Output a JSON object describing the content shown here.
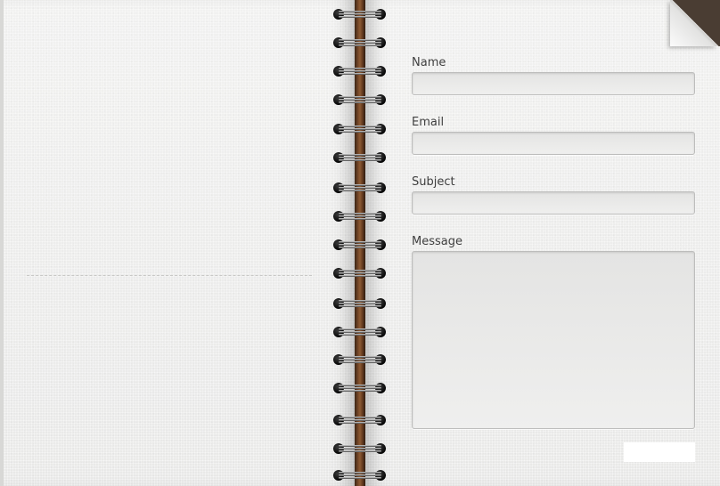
{
  "form": {
    "name_label": "Name",
    "name_value": "",
    "email_label": "Email",
    "email_value": "",
    "subject_label": "Subject",
    "subject_value": "",
    "message_label": "Message",
    "message_value": "",
    "submit_label": ""
  },
  "colors": {
    "page": "#ececeb",
    "spine": "#7a4b2a",
    "label_text": "#3f3f3f",
    "input_border": "#bdbdbc"
  }
}
